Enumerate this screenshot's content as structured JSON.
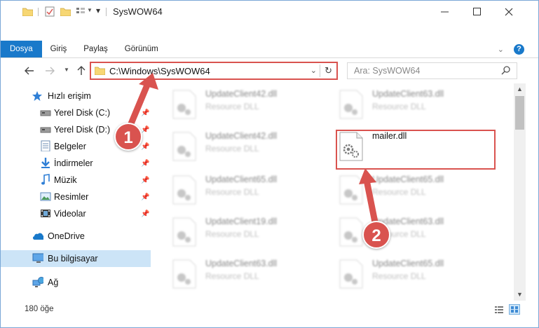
{
  "window": {
    "title": "SysWOW64"
  },
  "ribbon": {
    "tabs": [
      {
        "label": "Dosya",
        "active": true
      },
      {
        "label": "Giriş",
        "active": false
      },
      {
        "label": "Paylaş",
        "active": false
      },
      {
        "label": "Görünüm",
        "active": false
      }
    ]
  },
  "address": {
    "path": "C:\\Windows\\SysWOW64"
  },
  "search": {
    "placeholder": "Ara: SysWOW64"
  },
  "sidebar": {
    "items": [
      {
        "label": "Hızlı erişim",
        "icon": "star-icon"
      },
      {
        "label": "Yerel Disk (C:)",
        "icon": "drive-icon"
      },
      {
        "label": "Yerel Disk (D:)",
        "icon": "drive-icon"
      },
      {
        "label": "Belgeler",
        "icon": "documents-icon"
      },
      {
        "label": "İndirmeler",
        "icon": "download-icon"
      },
      {
        "label": "Müzik",
        "icon": "music-icon"
      },
      {
        "label": "Resimler",
        "icon": "pictures-icon"
      },
      {
        "label": "Videolar",
        "icon": "videos-icon"
      },
      {
        "label": "OneDrive",
        "icon": "cloud-icon"
      },
      {
        "label": "Bu bilgisayar",
        "icon": "computer-icon",
        "selected": true
      },
      {
        "label": "Ağ",
        "icon": "network-icon"
      }
    ]
  },
  "files": [
    {
      "name": "UpdateClient42.dll",
      "type": "Resource DLL"
    },
    {
      "name": "UpdateClient63.dll",
      "type": "Resource DLL"
    },
    {
      "name": "UpdateClient42.dll",
      "type": "Resource DLL"
    },
    {
      "name": "mailer.dll",
      "type": ""
    },
    {
      "name": "UpdateClient65.dll",
      "type": "Resource DLL"
    },
    {
      "name": "UpdateClient65.dll",
      "type": "Resource DLL"
    },
    {
      "name": "UpdateClient19.dll",
      "type": "Resource DLL"
    },
    {
      "name": "UpdateClient63.dll",
      "type": "Resource DLL"
    },
    {
      "name": "UpdateClient63.dll",
      "type": "Resource DLL"
    },
    {
      "name": "UpdateClient65.dll",
      "type": "Resource DLL"
    }
  ],
  "status": {
    "count": "180 öğe"
  },
  "callouts": {
    "one": "1",
    "two": "2"
  },
  "colors": {
    "accent": "#1979ca",
    "highlight": "#d9534f"
  }
}
